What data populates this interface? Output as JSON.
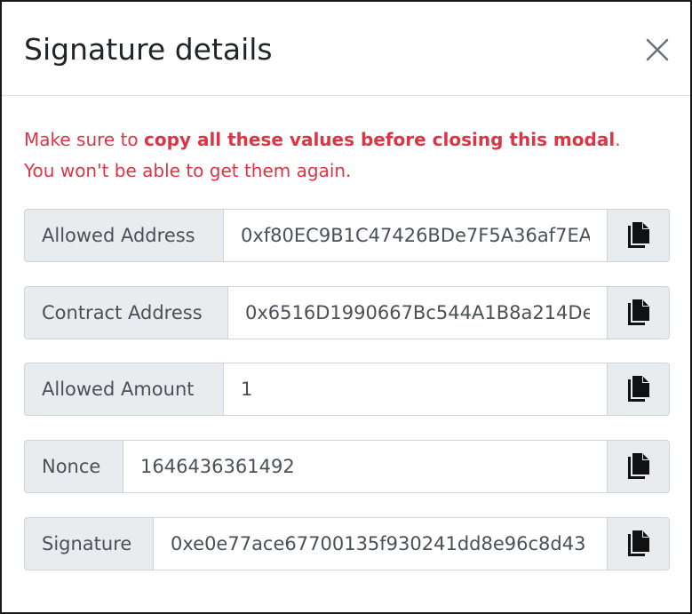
{
  "modal": {
    "title": "Signature details",
    "close_icon": "close-icon"
  },
  "warning": {
    "prefix": "Make sure to ",
    "emphasis": "copy all these values before closing this modal",
    "suffix": ".",
    "line2": "You won't be able to get them again."
  },
  "fields": [
    {
      "label": "Allowed Address",
      "value": "0xf80EC9B1C47426BDe7F5A36af7EA",
      "icon": "copy-icon"
    },
    {
      "label": "Contract Address",
      "value": "0x6516D1990667Bc544A1B8a214De",
      "icon": "copy-icon"
    },
    {
      "label": "Allowed Amount",
      "value": "1",
      "icon": "copy-icon"
    },
    {
      "label": "Nonce",
      "value": "1646436361492",
      "icon": "copy-icon"
    },
    {
      "label": "Signature",
      "value": "0xe0e77ace67700135f930241dd8e96c8d43",
      "icon": "copy-icon"
    }
  ],
  "colors": {
    "warning": "#dc3545",
    "addon_bg": "#e9ecef",
    "border": "#ced4da",
    "text": "#495057"
  }
}
